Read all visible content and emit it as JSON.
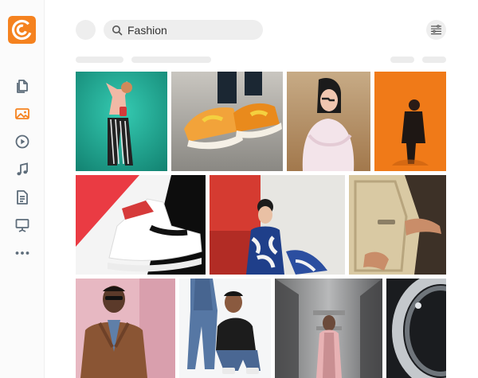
{
  "app": {
    "logo_icon": "brand-logo-icon",
    "brand_color": "#f5821f"
  },
  "sidebar": {
    "items": [
      {
        "icon": "documents-icon",
        "active": false
      },
      {
        "icon": "images-icon",
        "active": true
      },
      {
        "icon": "video-play-icon",
        "active": false
      },
      {
        "icon": "music-note-icon",
        "active": false
      },
      {
        "icon": "text-file-icon",
        "active": false
      },
      {
        "icon": "presentation-icon",
        "active": false
      },
      {
        "icon": "more-dots-icon",
        "active": false
      }
    ],
    "active_color": "#f5821f",
    "icon_color": "#5d6c7a"
  },
  "header": {
    "search": {
      "value": "Fashion",
      "icon": "search-icon"
    },
    "filter_icon": "filter-sliders-icon"
  },
  "gallery": {
    "images": [
      {
        "name": "woman-striped-pants-teal-wall"
      },
      {
        "name": "orange-sneakers-closeup"
      },
      {
        "name": "woman-white-blouse-field"
      },
      {
        "name": "woman-orange-wall"
      },
      {
        "name": "high-top-sneaker-red-background"
      },
      {
        "name": "woman-blue-floral-dress"
      },
      {
        "name": "vintage-car-door-hand"
      },
      {
        "name": "man-brown-leather-jacket"
      },
      {
        "name": "couple-denim-crouching"
      },
      {
        "name": "woman-pink-coat-corridor"
      },
      {
        "name": "metal-ring-closeup"
      }
    ]
  }
}
